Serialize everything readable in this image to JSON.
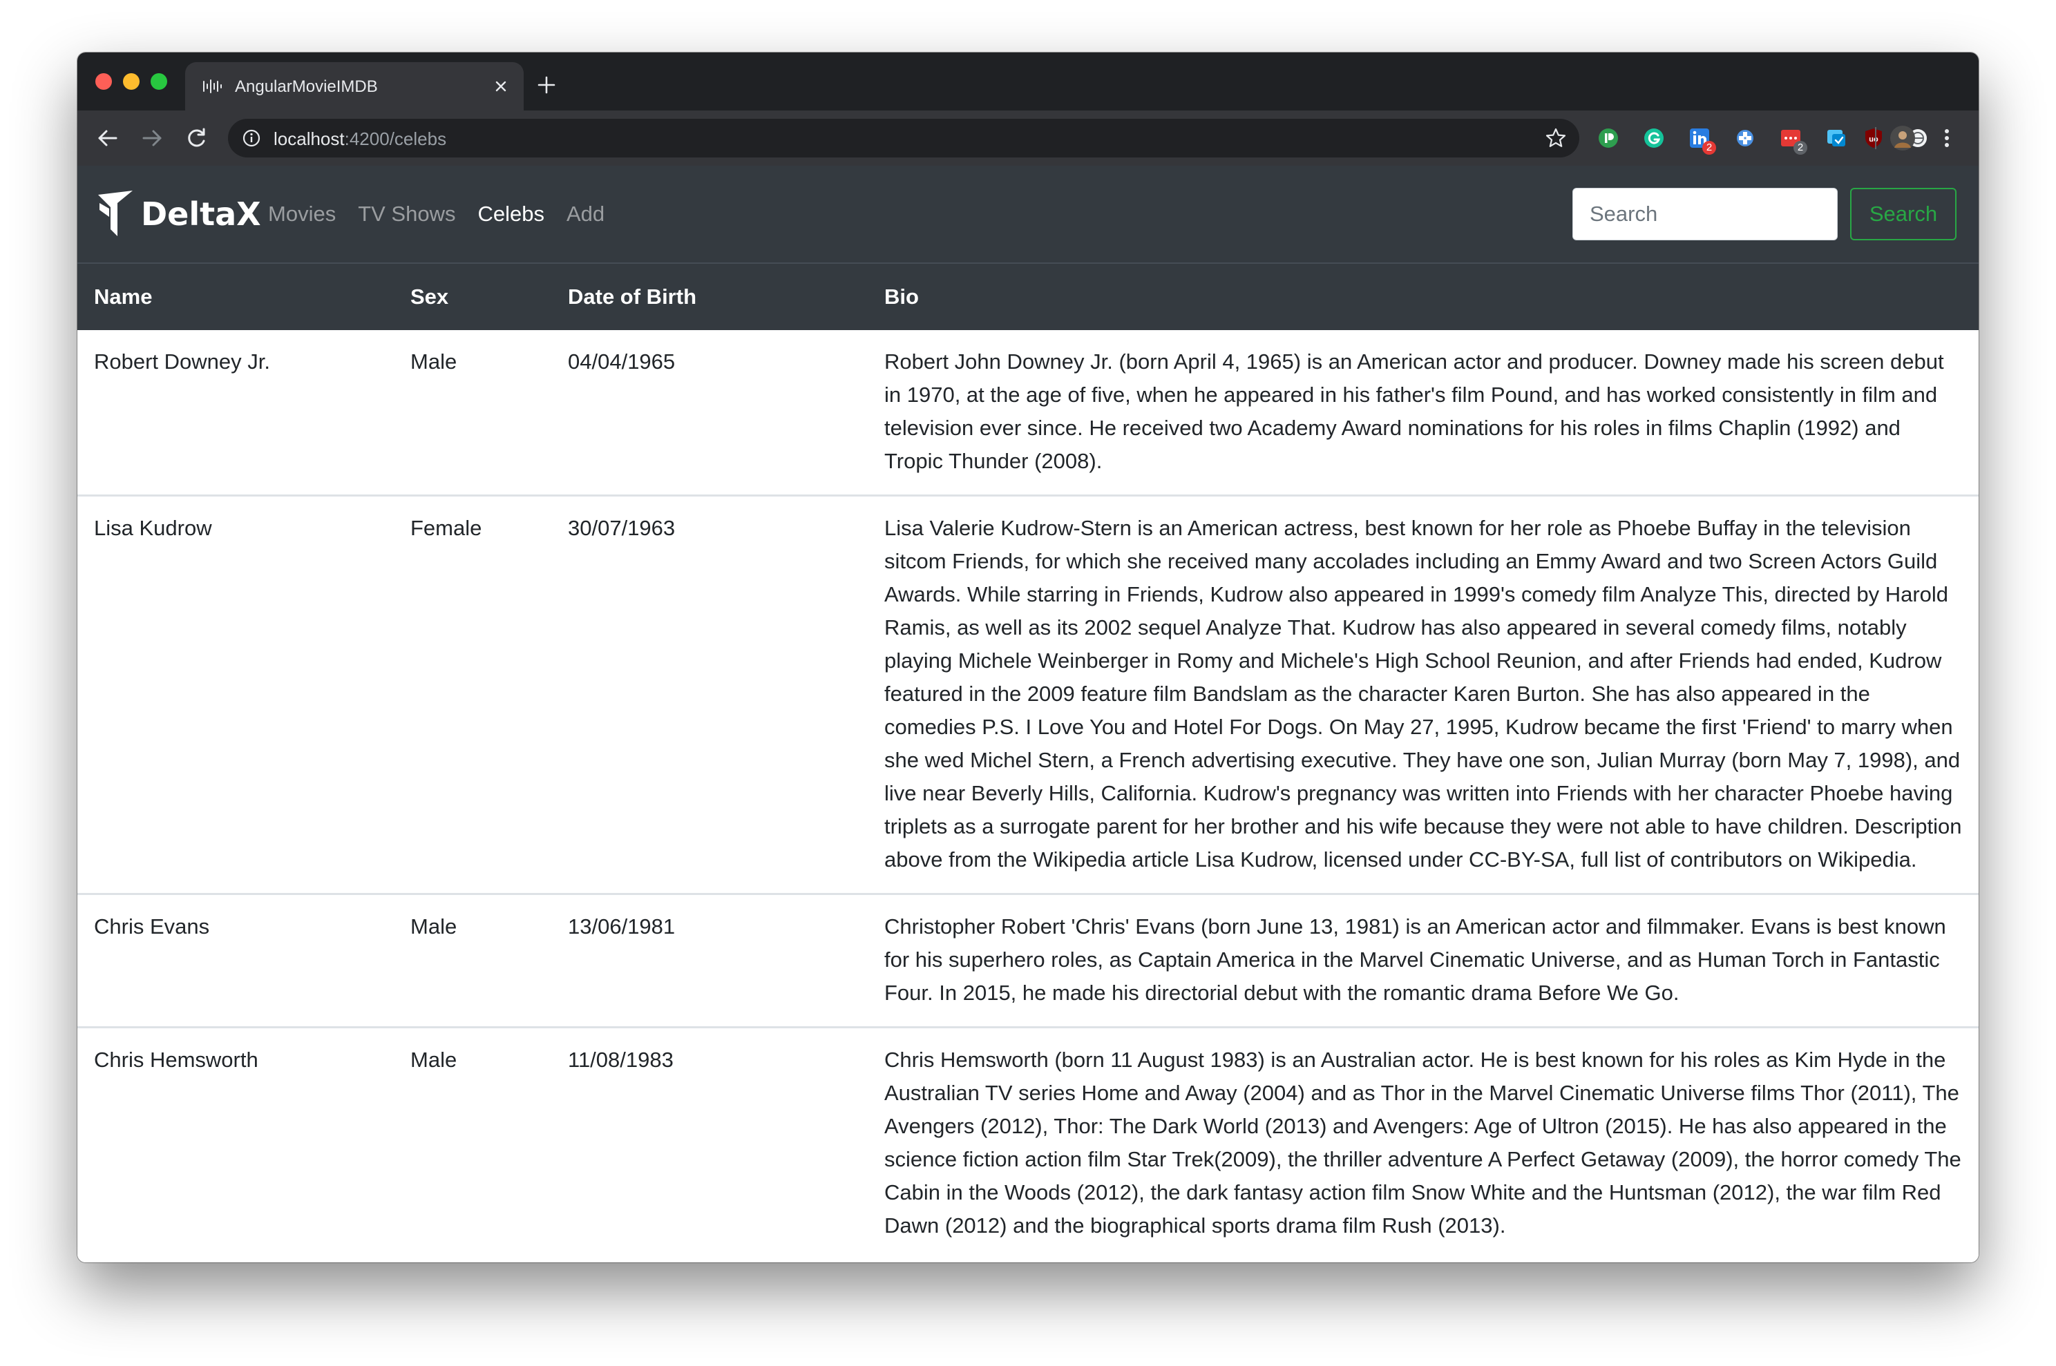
{
  "browser": {
    "tab_title": "AngularMovieIMDB",
    "url_host": "localhost",
    "url_path": ":4200/celebs",
    "extension_badges": [
      "2",
      "2"
    ]
  },
  "app": {
    "brand": "DeltaX",
    "nav": [
      {
        "label": "Movies",
        "active": false
      },
      {
        "label": "TV Shows",
        "active": false
      },
      {
        "label": "Celebs",
        "active": true
      },
      {
        "label": "Add",
        "active": false
      }
    ],
    "search_placeholder": "Search",
    "search_button": "Search"
  },
  "colors": {
    "navbar_bg": "#343a40",
    "success": "#28a745"
  },
  "table": {
    "headers": [
      "Name",
      "Sex",
      "Date of Birth",
      "Bio"
    ],
    "rows": [
      {
        "name": "Robert Downey Jr.",
        "sex": "Male",
        "dob": "04/04/1965",
        "bio": "Robert John Downey Jr. (born April 4, 1965) is an American actor and producer. Downey made his screen debut in 1970, at the age of five, when he appeared in his father's film Pound, and has worked consistently in film and television ever since. He received two Academy Award nominations for his roles in films Chaplin (1992) and Tropic Thunder (2008)."
      },
      {
        "name": "Lisa Kudrow",
        "sex": "Female",
        "dob": "30/07/1963",
        "bio": "Lisa Valerie Kudrow-Stern is an American actress, best known for her role as Phoebe Buffay in the television sitcom Friends, for which she received many accolades including an Emmy Award and two Screen Actors Guild Awards. While starring in Friends, Kudrow also appeared in 1999's comedy film Analyze This, directed by Harold Ramis, as well as its 2002 sequel Analyze That. Kudrow has also appeared in several comedy films, notably playing Michele Weinberger in Romy and Michele's High School Reunion, and after Friends had ended, Kudrow featured in the 2009 feature film Bandslam as the character Karen Burton. She has also appeared in the comedies P.S. I Love You and Hotel For Dogs. On May 27, 1995, Kudrow became the first 'Friend' to marry when she wed Michel Stern, a French advertising executive. They have one son, Julian Murray (born May 7, 1998), and live near Beverly Hills, California. Kudrow's pregnancy was written into Friends with her character Phoebe having triplets as a surrogate parent for her brother and his wife because they were not able to have children. Description above from the Wikipedia article Lisa Kudrow, licensed under CC-BY-SA, full list of contributors on Wikipedia."
      },
      {
        "name": "Chris Evans",
        "sex": "Male",
        "dob": "13/06/1981",
        "bio": "Christopher Robert 'Chris' Evans (born June 13, 1981) is an American actor and filmmaker. Evans is best known for his superhero roles, as Captain America in the Marvel Cinematic Universe, and as Human Torch in Fantastic Four. In 2015, he made his directorial debut with the romantic drama Before We Go."
      },
      {
        "name": "Chris Hemsworth",
        "sex": "Male",
        "dob": "11/08/1983",
        "bio": "Chris Hemsworth (born 11 August 1983) is an Australian actor. He is best known for his roles as Kim Hyde in the Australian TV series Home and Away (2004) and as Thor in the Marvel Cinematic Universe films Thor (2011), The Avengers (2012), Thor: The Dark World (2013) and Avengers: Age of Ultron (2015). He has also appeared in the science fiction action film Star Trek(2009), the thriller adventure A Perfect Getaway (2009), the horror comedy The Cabin in the Woods (2012), the dark fantasy action film Snow White and the Huntsman (2012), the war film Red Dawn (2012) and the biographical sports drama film Rush (2013)."
      }
    ]
  }
}
